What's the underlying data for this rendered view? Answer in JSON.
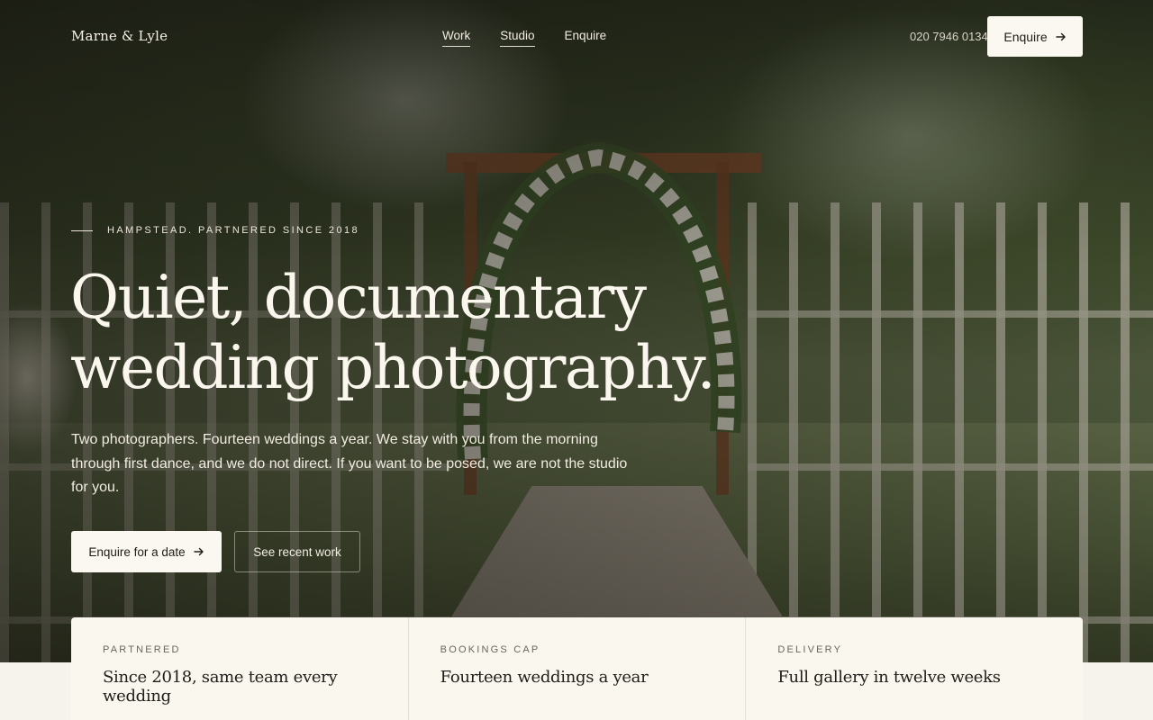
{
  "brand": {
    "logo": "Marne & Lyle"
  },
  "nav": {
    "items": [
      {
        "label": "Work"
      },
      {
        "label": "Studio"
      },
      {
        "label": "Enquire"
      }
    ],
    "phone": "020 7946 0134",
    "enquire_label": "Enquire"
  },
  "hero": {
    "eyebrow": "HAMPSTEAD. PARTNERED SINCE 2018",
    "headline_line1": "Quiet, documentary",
    "headline_line2": "wedding photography.",
    "lede": "Two photographers. Fourteen weddings a year. We stay with you from the morning through first dance, and we do not direct. If you want to be posed, we are not the studio for you.",
    "primary_cta": "Enquire for a date",
    "secondary_cta": "See recent work"
  },
  "stats": [
    {
      "label": "PARTNERED",
      "value": "Since 2018, same team every wedding"
    },
    {
      "label": "BOOKINGS CAP",
      "value": "Fourteen weddings a year"
    },
    {
      "label": "DELIVERY",
      "value": "Full gallery in twelve weeks"
    }
  ],
  "colors": {
    "cream": "#fbf8f1",
    "ink": "#1f1d19",
    "panel": "#faf7ef"
  }
}
